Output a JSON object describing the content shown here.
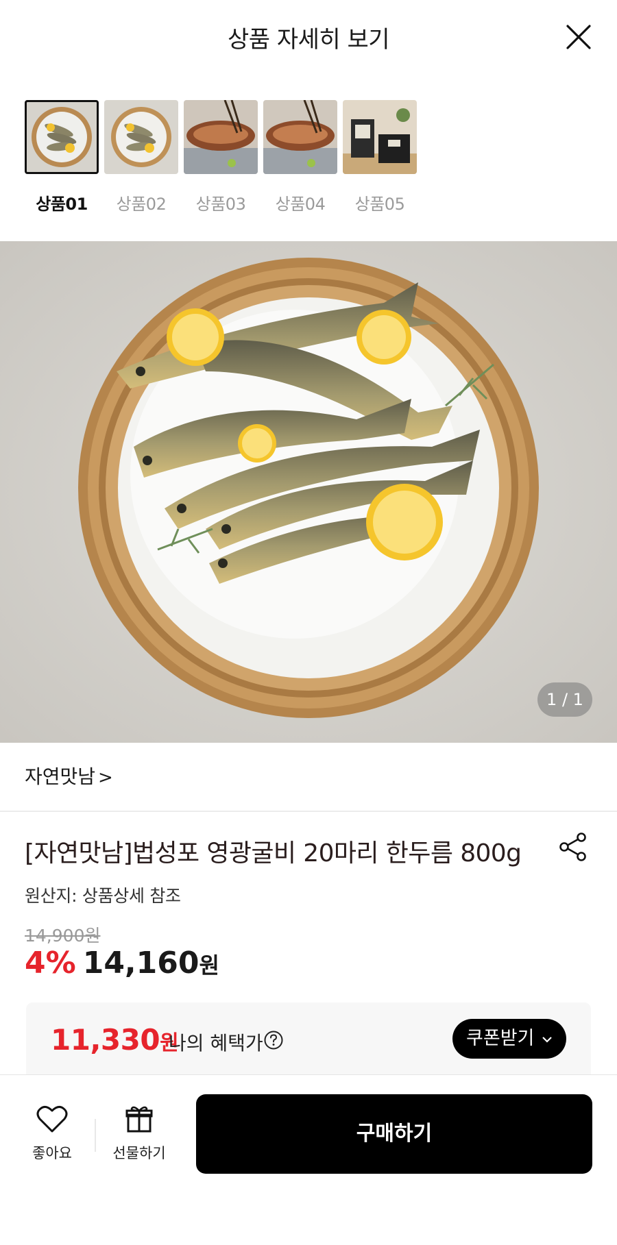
{
  "header": {
    "title": "상품 자세히 보기",
    "close_icon": "close-icon"
  },
  "thumbnails": [
    {
      "label": "상품01",
      "active": true,
      "icon": "fish-on-salt-thumbnail"
    },
    {
      "label": "상품02",
      "active": false,
      "icon": "fish-on-salt-thumbnail"
    },
    {
      "label": "상품03",
      "active": false,
      "icon": "grilled-fish-thumbnail"
    },
    {
      "label": "상품04",
      "active": false,
      "icon": "grilled-fish-thumbnail"
    },
    {
      "label": "상품05",
      "active": false,
      "icon": "gift-box-thumbnail"
    }
  ],
  "main_image": {
    "page_indicator": "1 / 1"
  },
  "brand": {
    "name": "자연맛남",
    "chevron": ">"
  },
  "product": {
    "title": "[자연맛남]법성포 영광굴비 20마리 한두름 800g",
    "origin": "원산지: 상품상세 참조",
    "original_price": "14,900원",
    "discount": "4%",
    "price": "14,160",
    "currency": "원"
  },
  "benefit": {
    "price": "11,330",
    "currency": "원",
    "label": "나의 혜택가",
    "coupon_button": "쿠폰받기"
  },
  "bottom_bar": {
    "like_label": "좋아요",
    "gift_label": "선물하기",
    "buy_label": "구매하기"
  },
  "colors": {
    "accent_red": "#e6242c",
    "button_black": "#000000"
  }
}
